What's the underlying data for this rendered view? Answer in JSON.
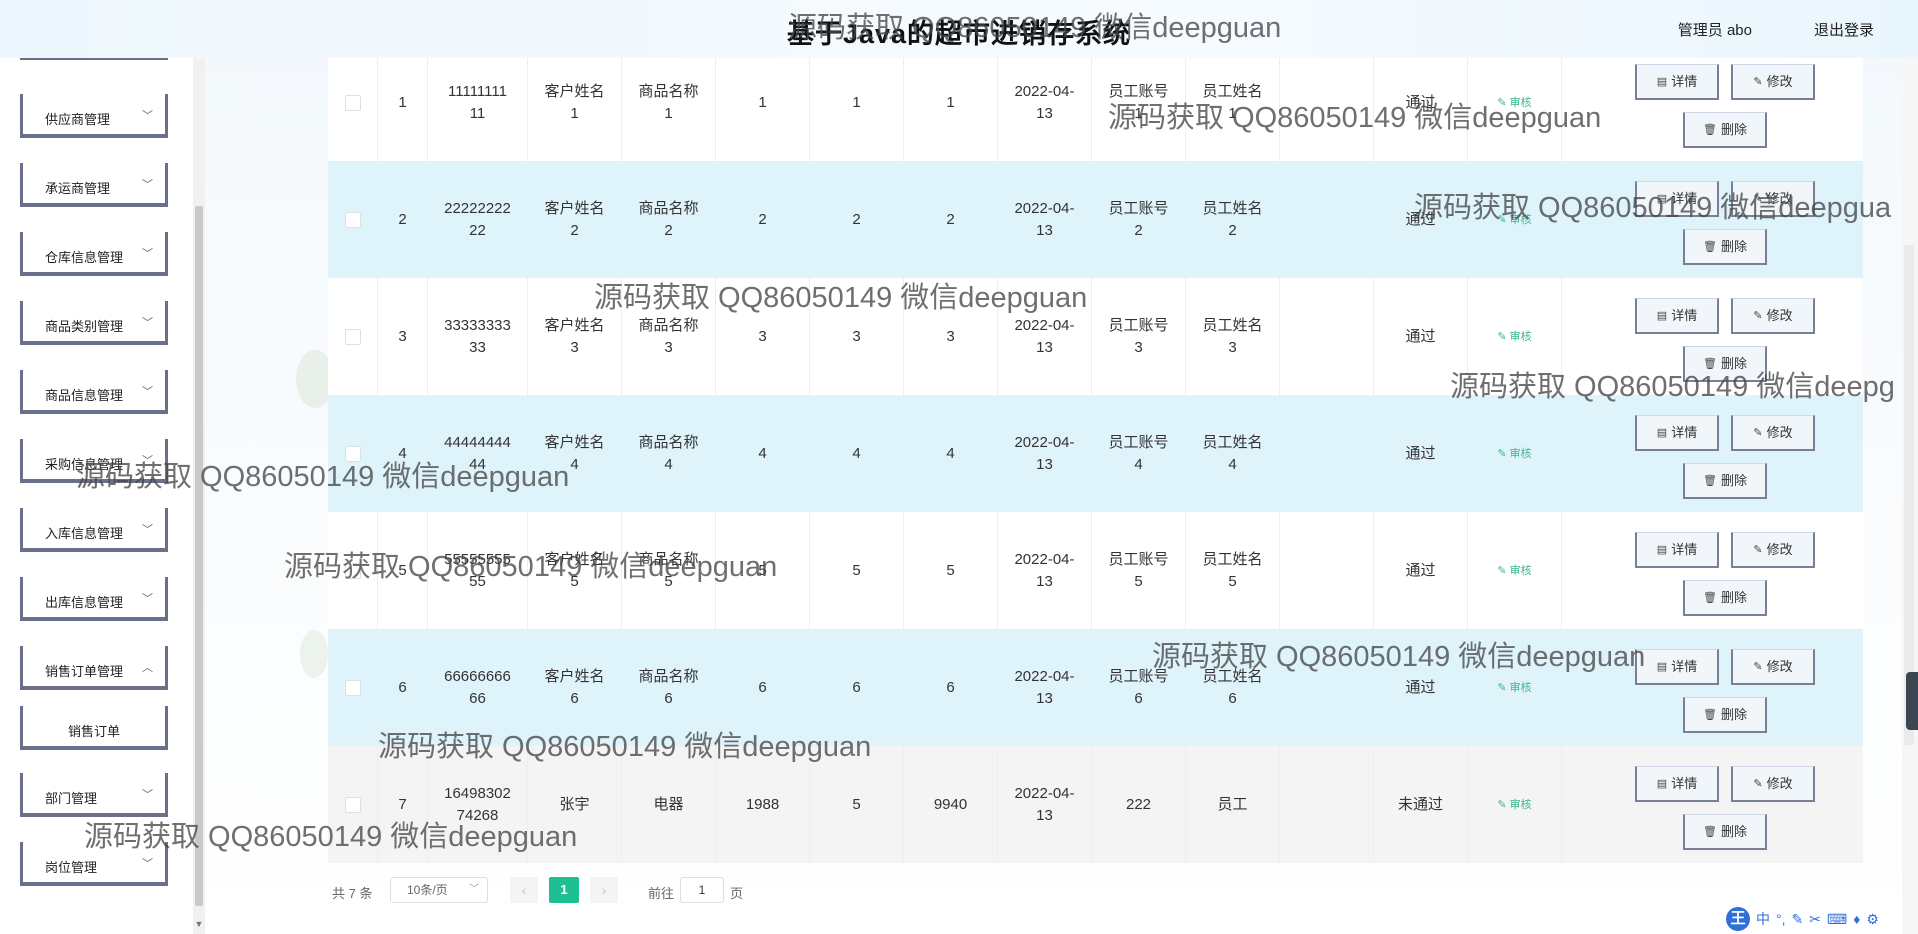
{
  "header": {
    "title": "基于Java的超市进销存系统",
    "user": "管理员 abo",
    "logout": "退出登录"
  },
  "sidebar": {
    "items": [
      {
        "label": "供应商管理",
        "chevron": "chevron-down-icon"
      },
      {
        "label": "承运商管理",
        "chevron": "chevron-down-icon"
      },
      {
        "label": "仓库信息管理",
        "chevron": "chevron-down-icon"
      },
      {
        "label": "商品类别管理",
        "chevron": "chevron-down-icon"
      },
      {
        "label": "商品信息管理",
        "chevron": "chevron-down-icon"
      },
      {
        "label": "采购信息管理",
        "chevron": "chevron-down-icon"
      },
      {
        "label": "入库信息管理",
        "chevron": "chevron-down-icon"
      },
      {
        "label": "出库信息管理",
        "chevron": "chevron-down-icon"
      },
      {
        "label": "销售订单管理",
        "chevron": "chevron-up-icon"
      },
      {
        "label": "销售订单",
        "sub": true
      },
      {
        "label": "部门管理",
        "chevron": "chevron-down-icon"
      },
      {
        "label": "岗位管理",
        "chevron": "chevron-down-icon"
      }
    ]
  },
  "table": {
    "rows": [
      {
        "index": "1",
        "order_no": "11111111\n11",
        "customer": "客户姓名\n1",
        "product": "商品名称\n1",
        "price": "1",
        "qty": "1",
        "total": "1",
        "date": "2022-04-\n13",
        "emp_account": "员工账号\n1",
        "emp_name": "员工姓名\n1",
        "status": "通过",
        "audit": "审核"
      },
      {
        "index": "2",
        "order_no": "22222222\n22",
        "customer": "客户姓名\n2",
        "product": "商品名称\n2",
        "price": "2",
        "qty": "2",
        "total": "2",
        "date": "2022-04-\n13",
        "emp_account": "员工账号\n2",
        "emp_name": "员工姓名\n2",
        "status": "通过",
        "audit": "审核"
      },
      {
        "index": "3",
        "order_no": "33333333\n33",
        "customer": "客户姓名\n3",
        "product": "商品名称\n3",
        "price": "3",
        "qty": "3",
        "total": "3",
        "date": "2022-04-\n13",
        "emp_account": "员工账号\n3",
        "emp_name": "员工姓名\n3",
        "status": "通过",
        "audit": "审核"
      },
      {
        "index": "4",
        "order_no": "44444444\n44",
        "customer": "客户姓名\n4",
        "product": "商品名称\n4",
        "price": "4",
        "qty": "4",
        "total": "4",
        "date": "2022-04-\n13",
        "emp_account": "员工账号\n4",
        "emp_name": "员工姓名\n4",
        "status": "通过",
        "audit": "审核"
      },
      {
        "index": "5",
        "order_no": "55555555\n55",
        "customer": "客户姓名\n5",
        "product": "商品名称\n5",
        "price": "5",
        "qty": "5",
        "total": "5",
        "date": "2022-04-\n13",
        "emp_account": "员工账号\n5",
        "emp_name": "员工姓名\n5",
        "status": "通过",
        "audit": "审核"
      },
      {
        "index": "6",
        "order_no": "66666666\n66",
        "customer": "客户姓名\n6",
        "product": "商品名称\n6",
        "price": "6",
        "qty": "6",
        "total": "6",
        "date": "2022-04-\n13",
        "emp_account": "员工账号\n6",
        "emp_name": "员工姓名\n6",
        "status": "通过",
        "audit": "审核"
      },
      {
        "index": "7",
        "order_no": "16498302\n74268",
        "customer": "张宇",
        "product": "电器",
        "price": "1988",
        "qty": "5",
        "total": "9940",
        "date": "2022-04-\n13",
        "emp_account": "222",
        "emp_name": "员工",
        "status": "未通过",
        "audit": "审核"
      }
    ],
    "buttons": {
      "detail": "详情",
      "edit": "修改",
      "delete": "删除"
    }
  },
  "pagination": {
    "total": "共 7 条",
    "page_size": "10条/页",
    "current_page": "1",
    "goto_prefix": "前往",
    "goto_value": "1",
    "goto_suffix": "页"
  },
  "ime": {
    "logo": "王",
    "lang": "中"
  },
  "watermarks": [
    "源码获取 QQ86050149 微信deepguan",
    "源码获取 QQ86050149 微信deepguan",
    "源码获取 QQ86050149 微信deepgua",
    "源码获取 QQ86050149 微信deepguan",
    "源码获取 QQ86050149 微信deepg",
    "源码获取 QQ86050149 微信deepguan",
    "源码获取 QQ86050149 微信deepguan",
    "源码获取 QQ86050149 微信deepguan",
    "源码获取 QQ86050149 微信deepguan",
    "源码获取 QQ86050149 微信deepguan"
  ],
  "colors": {
    "accent": "#1dc093",
    "row_highlight": "#dff3fb",
    "audit": "#3cb58e"
  }
}
